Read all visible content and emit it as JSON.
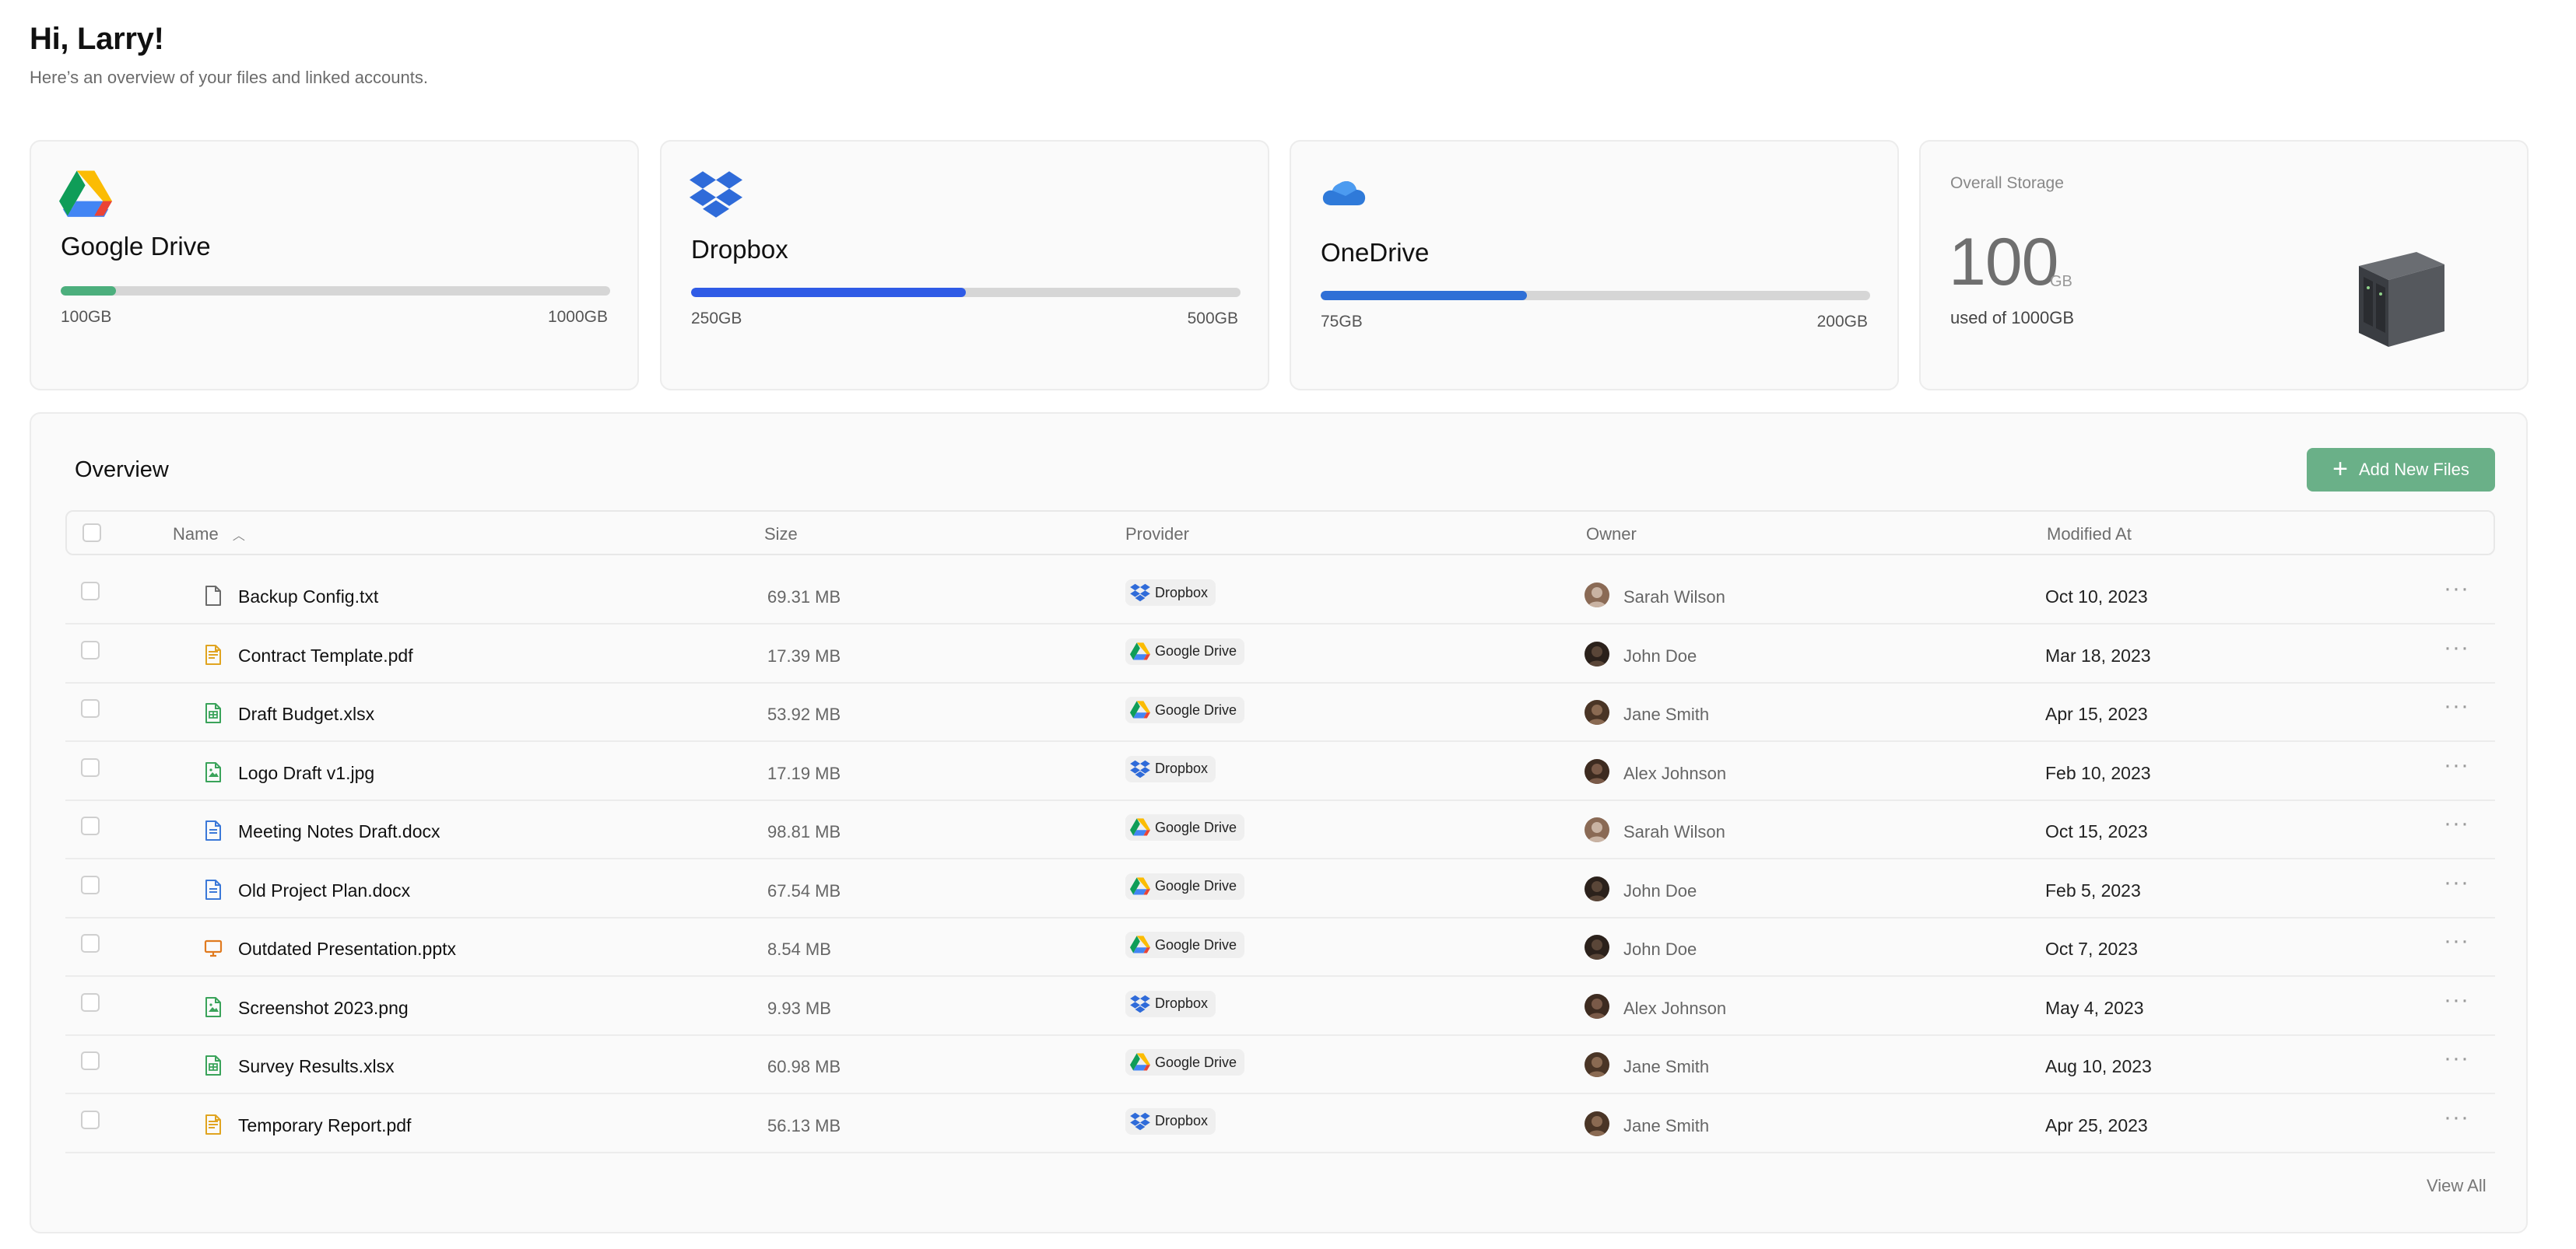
{
  "header": {
    "greeting": "Hi, Larry!",
    "subtitle": "Here’s an overview of your files and linked accounts."
  },
  "accounts": [
    {
      "name": "Google Drive",
      "used_label": "100GB",
      "total_label": "1000GB",
      "fraction_used": 0.1,
      "bar_color": "#4caf7d",
      "icon": "google-drive-icon"
    },
    {
      "name": "Dropbox",
      "used_label": "250GB",
      "total_label": "500GB",
      "fraction_used": 0.5,
      "bar_color": "#2f5be6",
      "icon": "dropbox-icon"
    },
    {
      "name": "OneDrive",
      "used_label": "75GB",
      "total_label": "200GB",
      "fraction_used": 0.375,
      "bar_color": "#2f6fd6",
      "icon": "onedrive-icon"
    }
  ],
  "storage": {
    "title": "Overall Storage",
    "amount": "100",
    "unit": "GB",
    "used_text": "used of 1000GB",
    "icon": "nas-server-icon"
  },
  "overview": {
    "title": "Overview",
    "add_button_label": "Add New Files",
    "view_all_label": "View All",
    "columns": {
      "name": "Name",
      "size": "Size",
      "provider": "Provider",
      "owner": "Owner",
      "modified": "Modified At"
    },
    "files": [
      {
        "name": "Backup Config.txt",
        "icon": "text-file-icon",
        "size": "69.31 MB",
        "provider": "Dropbox",
        "owner": "Sarah Wilson",
        "modified": "Oct 10, 2023"
      },
      {
        "name": "Contract Template.pdf",
        "icon": "pdf-file-icon",
        "size": "17.39 MB",
        "provider": "Google Drive",
        "owner": "John Doe",
        "modified": "Mar 18, 2023"
      },
      {
        "name": "Draft Budget.xlsx",
        "icon": "spreadsheet-file-icon",
        "size": "53.92 MB",
        "provider": "Google Drive",
        "owner": "Jane Smith",
        "modified": "Apr 15, 2023"
      },
      {
        "name": "Logo Draft v1.jpg",
        "icon": "image-file-icon",
        "size": "17.19 MB",
        "provider": "Dropbox",
        "owner": "Alex Johnson",
        "modified": "Feb 10, 2023"
      },
      {
        "name": "Meeting Notes Draft.docx",
        "icon": "document-file-icon",
        "size": "98.81 MB",
        "provider": "Google Drive",
        "owner": "Sarah Wilson",
        "modified": "Oct 15, 2023"
      },
      {
        "name": "Old Project Plan.docx",
        "icon": "document-file-icon",
        "size": "67.54 MB",
        "provider": "Google Drive",
        "owner": "John Doe",
        "modified": "Feb 5, 2023"
      },
      {
        "name": "Outdated Presentation.pptx",
        "icon": "presentation-file-icon",
        "size": "8.54 MB",
        "provider": "Google Drive",
        "owner": "John Doe",
        "modified": "Oct 7, 2023"
      },
      {
        "name": "Screenshot 2023.png",
        "icon": "image-file-icon",
        "size": "9.93 MB",
        "provider": "Dropbox",
        "owner": "Alex Johnson",
        "modified": "May 4, 2023"
      },
      {
        "name": "Survey Results.xlsx",
        "icon": "spreadsheet-file-icon",
        "size": "60.98 MB",
        "provider": "Google Drive",
        "owner": "Jane Smith",
        "modified": "Aug 10, 2023"
      },
      {
        "name": "Temporary Report.pdf",
        "icon": "pdf-file-icon",
        "size": "56.13 MB",
        "provider": "Dropbox",
        "owner": "Jane Smith",
        "modified": "Apr 25, 2023"
      }
    ]
  },
  "colors": {
    "accent_green": "#6ab088",
    "google_green": "#4caf7d",
    "dropbox_blue": "#2f5be6",
    "onedrive_blue": "#2f6fd6"
  }
}
